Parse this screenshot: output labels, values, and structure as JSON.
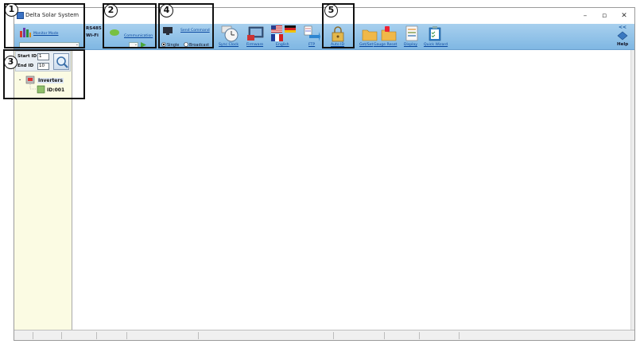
{
  "window": {
    "title": "Delta Solar System",
    "minimize": "–",
    "restore": "▫",
    "close": "✕"
  },
  "ribbon": {
    "monitor_mode": "Monitor Mode",
    "interfaces": [
      "RS485",
      "Wi-Fi"
    ],
    "communication": "Communication",
    "send_command": "Send Command",
    "radio_single": "Single",
    "radio_broadcast": "Broadcast",
    "sync_clock": "Sync Clock",
    "firmware": "Firmware",
    "language": "English",
    "ftp": "FTP",
    "auto_id": "Auto ID",
    "get_set": "Get/Set",
    "gauge_reset": "Gauge Reset",
    "display": "Display",
    "quick_wizard": "Quick Wizard",
    "help": "Help",
    "collapse": "<<"
  },
  "left_panel": {
    "start_id_label": "Start ID",
    "start_id_value": "1",
    "end_id_label": "End ID",
    "end_id_value": "10",
    "tree_root": "Inverters",
    "tree_child": "ID:001"
  },
  "callouts": [
    "1",
    "2",
    "3",
    "4",
    "5"
  ],
  "colors": {
    "ribbon_top": "#a8d0ee",
    "ribbon_bottom": "#7fb7e3",
    "link": "#0a48a0",
    "left_panel_bg": "#fbfbe3"
  }
}
